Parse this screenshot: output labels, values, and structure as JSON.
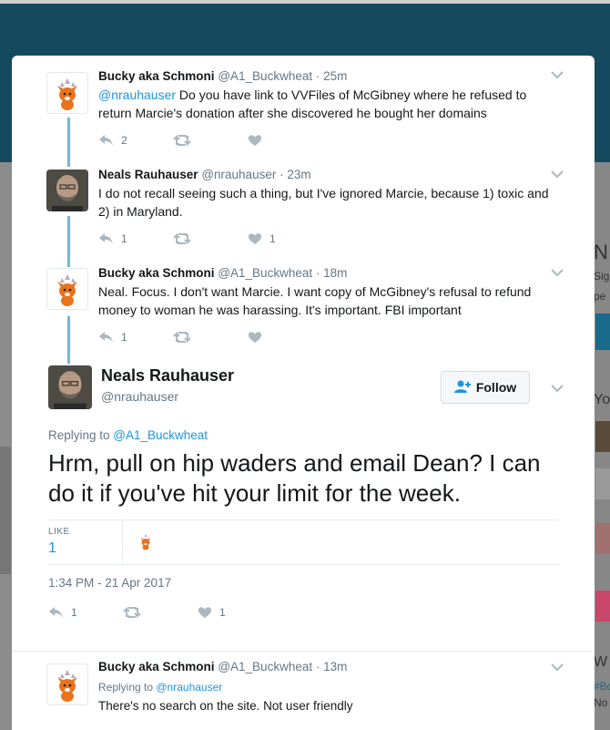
{
  "colors": {
    "accent": "#1b95e0",
    "thread_line": "#70b7d3",
    "muted": "#657786",
    "icon": "#aab8c2",
    "header_bg": "#154a5e"
  },
  "background_sidebar": {
    "letters": [
      "N",
      "Sig",
      "pe",
      "Yo",
      "W",
      "#Bo",
      "No"
    ]
  },
  "tweets": [
    {
      "name": "Bucky aka Schmoni",
      "handle": "@A1_Buckwheat",
      "time": "· 25m",
      "mention": "@nrauhauser",
      "text": " Do you have link to VVFiles of McGibney where he refused to return Marcie's donation after she discovered he bought her domains",
      "replies": "2",
      "retweets": "",
      "likes": "",
      "avatar": "fox-icon"
    },
    {
      "name": "Neals Rauhauser",
      "handle": "@nrauhauser",
      "time": "· 23m",
      "text": "I do not recall seeing such a thing, but I've ignored Marcie, because 1) toxic and 2) in Maryland.",
      "replies": "1",
      "retweets": "",
      "likes": "1",
      "avatar": "man-icon"
    },
    {
      "name": "Bucky aka Schmoni",
      "handle": "@A1_Buckwheat",
      "time": "· 18m",
      "text": "Neal. Focus. I don't want Marcie. I want copy of McGibney's refusal to refund money to woman he was harassing. It's important. FBI important",
      "replies": "1",
      "retweets": "",
      "likes": "",
      "avatar": "fox-icon"
    }
  ],
  "focused": {
    "name": "Neals Rauhauser",
    "handle": "@nrauhauser",
    "follow_label": "Follow",
    "replying_prefix": "Replying to ",
    "replying_to": "@A1_Buckwheat",
    "text": "Hrm, pull on hip waders and email Dean? I can do it if you've hit your limit for the week.",
    "like_label": "LIKE",
    "like_count": "1",
    "timestamp": "1:34 PM - 21 Apr 2017",
    "replies": "1",
    "retweets": "",
    "likes": "1"
  },
  "reply": {
    "name": "Bucky aka Schmoni",
    "handle": "@A1_Buckwheat",
    "time": "· 13m",
    "replying_prefix": "Replying to ",
    "replying_to": "@nrauhauser",
    "text": "There's no search on the site. Not user friendly"
  }
}
